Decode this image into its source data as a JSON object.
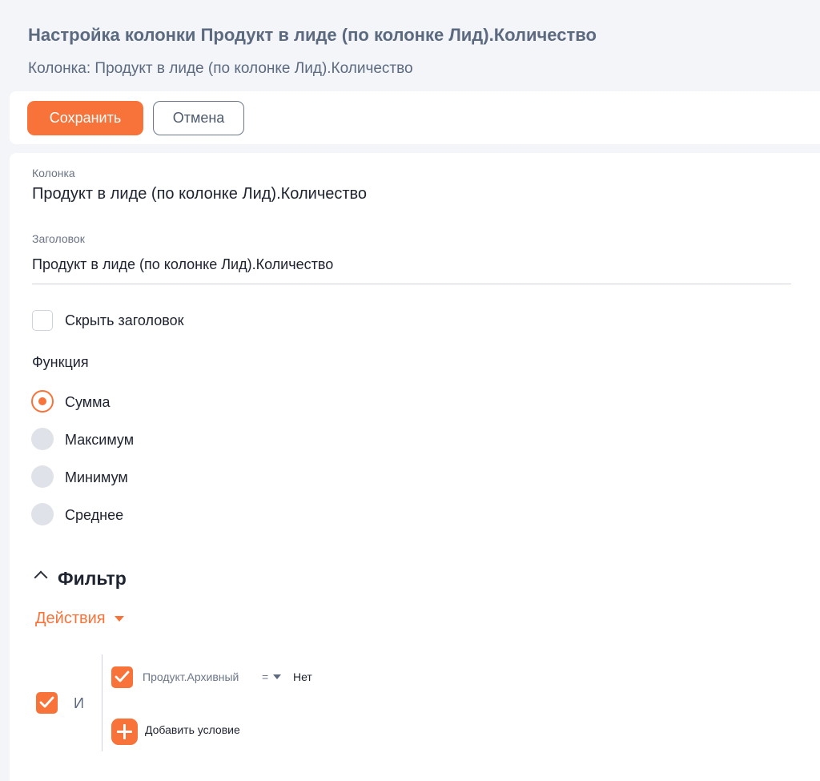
{
  "header": {
    "title": "Настройка колонки Продукт в лиде (по колонке Лид).Количество",
    "subtitle": "Колонка: Продукт в лиде (по колонке Лид).Количество"
  },
  "toolbar": {
    "save_label": "Сохранить",
    "cancel_label": "Отмена"
  },
  "form": {
    "column_label": "Колонка",
    "column_value": "Продукт в лиде (по колонке Лид).Количество",
    "title_label": "Заголовок",
    "title_value": "Продукт в лиде (по колонке Лид).Количество",
    "hide_title_label": "Скрыть заголовок",
    "hide_title_checked": false,
    "function_label": "Функция",
    "function_options": [
      "Сумма",
      "Максимум",
      "Минимум",
      "Среднее"
    ],
    "function_selected": "Сумма"
  },
  "filter": {
    "title": "Фильтр",
    "actions_label": "Действия",
    "group_operator": "И",
    "group_enabled": true,
    "conditions": [
      {
        "field": "Продукт.Архивный",
        "operator": "=",
        "value": "Нет",
        "enabled": true
      }
    ],
    "add_condition_label": "Добавить условие"
  },
  "colors": {
    "accent": "#f7733a",
    "title_gray": "#5c6a80",
    "background": "#f3f5f9"
  }
}
